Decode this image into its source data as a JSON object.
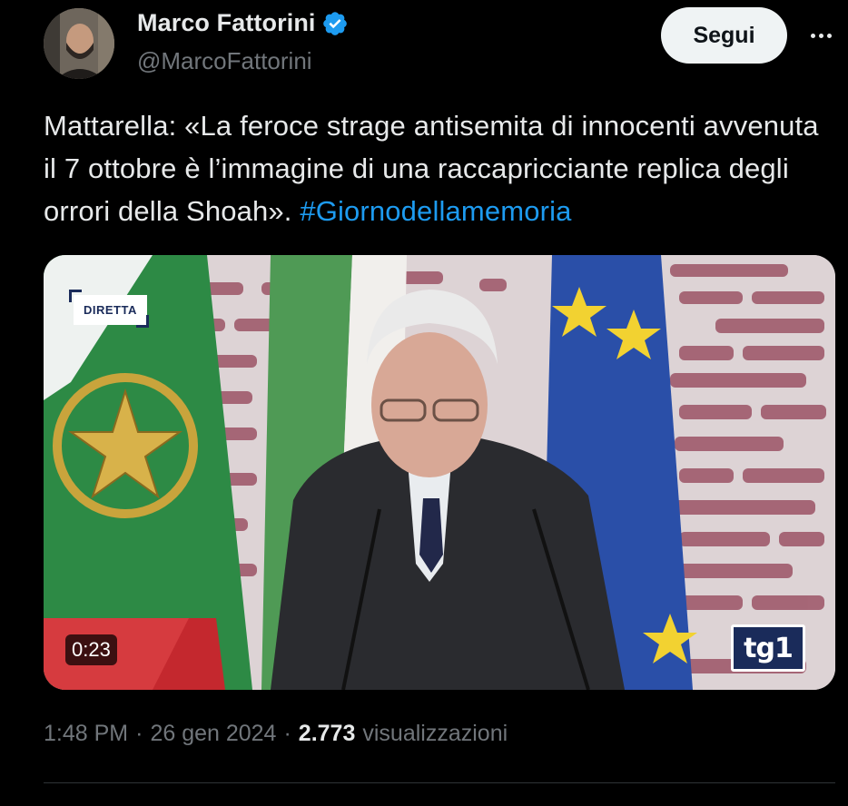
{
  "author": {
    "display_name": "Marco Fattorini",
    "handle": "@MarcoFattorini",
    "verified": true,
    "verified_icon": "verified-badge-icon"
  },
  "actions": {
    "follow_label": "Segui",
    "more_icon": "more-horizontal-icon"
  },
  "tweet": {
    "text_main": "Mattarella: «La feroce strage antisemita di innocenti avvenuta il 7 ottobre è l’immagine di una raccapricciante replica degli orrori della Shoah». ",
    "hashtag": "#Giornodellamemoria"
  },
  "media": {
    "live_badge": "DIRETTA",
    "duration": "0:23",
    "channel_logo": "tg1"
  },
  "meta": {
    "time": "1:48 PM",
    "separator": "·",
    "date": "26 gen 2024",
    "views_count": "2.773",
    "views_label": "visualizzazioni"
  },
  "colors": {
    "background": "#000000",
    "text": "#e7e9ea",
    "secondary_text": "#71767b",
    "link": "#1d9bf0",
    "follow_button_bg": "#eff3f4",
    "verified": "#1d9bf0"
  }
}
